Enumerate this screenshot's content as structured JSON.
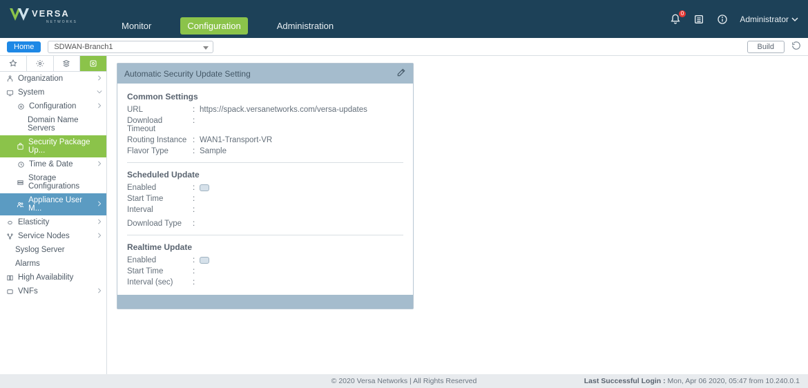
{
  "header": {
    "brand_main": "VERSA",
    "brand_sub": "NETWORKS",
    "tabs": [
      "Monitor",
      "Configuration",
      "Administration"
    ],
    "active_tab": 1,
    "notification_count": "0",
    "user": "Administrator"
  },
  "breadcrumb": {
    "home": "Home",
    "branch": "SDWAN-Branch1",
    "build": "Build"
  },
  "sidebar": {
    "items": [
      {
        "label": "Organization",
        "icon": "org-icon",
        "expand": "right"
      },
      {
        "label": "System",
        "icon": "system-icon",
        "expand": "down",
        "children": [
          {
            "label": "Configuration",
            "icon": "config-icon",
            "expand": "right",
            "children": [
              {
                "label": "Domain Name Servers"
              },
              {
                "label": "Security Package Up...",
                "active_green": true
              },
              {
                "label": "Time & Date",
                "icon": "clock-icon",
                "expand": "right"
              },
              {
                "label": "Storage Configurations",
                "icon": "storage-icon"
              },
              {
                "label": "Appliance User M...",
                "icon": "users-icon",
                "active_blue": true,
                "expand": "right"
              }
            ]
          }
        ]
      },
      {
        "label": "Elasticity",
        "icon": "elastic-icon",
        "expand": "right"
      },
      {
        "label": "Service Nodes",
        "icon": "nodes-icon",
        "expand": "right"
      },
      {
        "label": "Syslog Server",
        "icon": "syslog-icon"
      },
      {
        "label": "Alarms",
        "icon": "alarm-icon"
      },
      {
        "label": "High Availability",
        "icon": "ha-icon"
      },
      {
        "label": "VNFs",
        "icon": "vnf-icon",
        "expand": "right"
      }
    ]
  },
  "panel": {
    "title": "Automatic Security Update Setting",
    "sections": [
      {
        "title": "Common Settings",
        "rows": [
          {
            "k": "URL",
            "v": "https://spack.versanetworks.com/versa-updates"
          },
          {
            "k": "Download Timeout",
            "v": ""
          },
          {
            "k": "Routing Instance",
            "v": "WAN1-Transport-VR"
          },
          {
            "k": "Flavor Type",
            "v": "Sample"
          }
        ]
      },
      {
        "title": "Scheduled Update",
        "rows": [
          {
            "k": "Enabled",
            "toggle": true
          },
          {
            "k": "Start Time",
            "v": ""
          },
          {
            "k": "Interval",
            "v": ""
          },
          {
            "k": "Download Type",
            "v": ""
          }
        ]
      },
      {
        "title": "Realtime Update",
        "rows": [
          {
            "k": "Enabled",
            "toggle": true
          },
          {
            "k": "Start Time",
            "v": ""
          },
          {
            "k": "Interval (sec)",
            "v": ""
          }
        ]
      }
    ]
  },
  "footer": {
    "copyright": "© 2020 Versa Networks | All Rights Reserved",
    "login_label": "Last Successful Login : ",
    "login_value": "Mon, Apr 06 2020, 05:47 from 10.240.0.1"
  }
}
